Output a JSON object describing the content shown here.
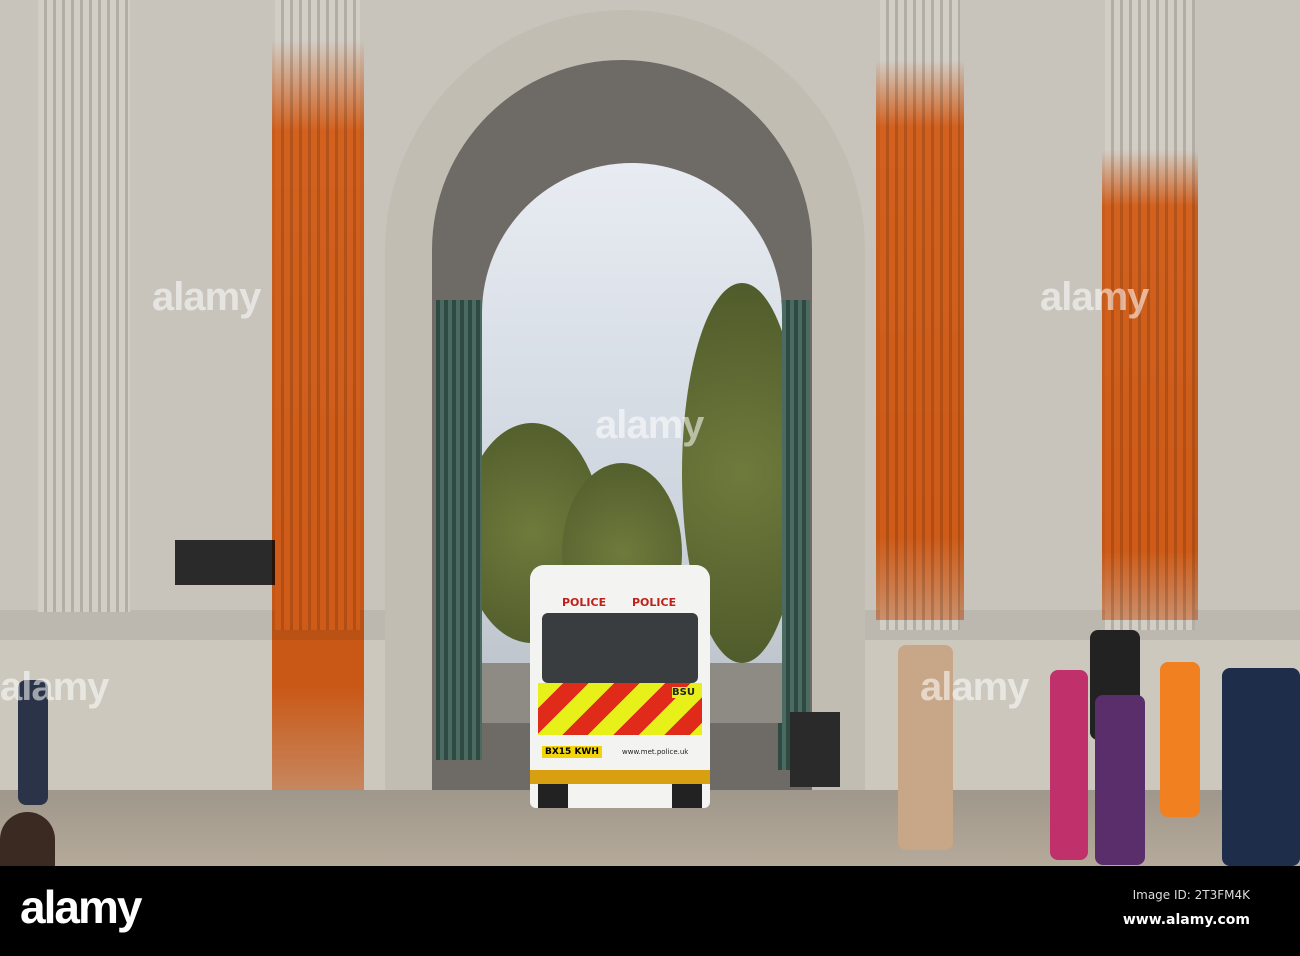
{
  "photo": {
    "van": {
      "label_left": "POLICE",
      "label_right": "POLICE",
      "unit": "BSU",
      "plate": "BX15 KWH",
      "website": "www.met.police.uk"
    },
    "watermarks": [
      "alamy",
      "alamy",
      "alamy",
      "alamy",
      "alamy"
    ]
  },
  "footer": {
    "logo": "alamy",
    "image_id": "Image ID: 2T3FM4K",
    "site": "www.alamy.com"
  },
  "colors": {
    "paint": "#ff6a12",
    "stone": "#c8c4bc",
    "van_chevron_yellow": "#e8f01a",
    "van_chevron_red": "#e02a1a"
  }
}
